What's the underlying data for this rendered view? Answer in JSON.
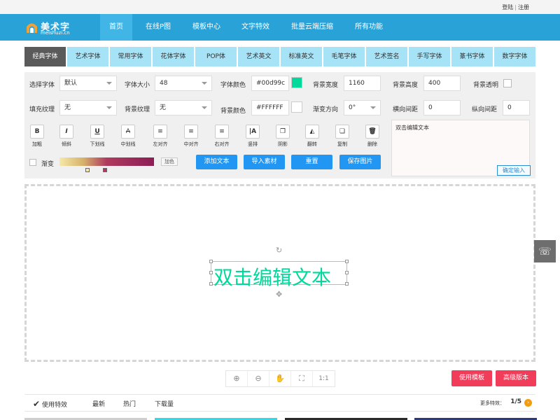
{
  "topbar": {
    "login": "登陆",
    "sep": "|",
    "register": "注册"
  },
  "logo": {
    "name": "美术字",
    "sub": "meishuzi.cn"
  },
  "nav": {
    "items": [
      "首页",
      "在线P图",
      "模板中心",
      "文字特效",
      "批量云端压缩",
      "所有功能"
    ]
  },
  "tabs": [
    "经典字体",
    "艺术字体",
    "常用字体",
    "花体字体",
    "POP体",
    "艺术英文",
    "标准英文",
    "毛笔字体",
    "艺术签名",
    "手写字体",
    "篆书字体",
    "数字字体"
  ],
  "form": {
    "font_label": "选择字体",
    "font_value": "默认",
    "size_label": "字体大小",
    "size_value": "48",
    "color_label": "字体颜色",
    "color_value": "#00d99c",
    "bgwidth_label": "背景宽度",
    "bgwidth_value": "1160",
    "bgheight_label": "背景高度",
    "bgheight_value": "400",
    "bgtrans_label": "背景透明",
    "fill_label": "填充纹理",
    "fill_value": "无",
    "bgtexture_label": "背景纹理",
    "bgtexture_value": "无",
    "bgcolor_label": "背景颜色",
    "bgcolor_value": "#FFFFFF",
    "graddir_label": "渐变方向",
    "graddir_value": "0°",
    "hgap_label": "横向间距",
    "hgap_value": "0",
    "vgap_label": "纵向间距",
    "vgap_value": "0",
    "gradient_label": "渐变",
    "addcolor_label": "加色"
  },
  "tools": [
    "加粗",
    "倾斜",
    "下划线",
    "中划线",
    "左对齐",
    "中对齐",
    "右对齐",
    "竖排",
    "阴影",
    "翻转",
    "复制",
    "删除"
  ],
  "actions": [
    "添加文本",
    "导入素材",
    "重置",
    "保存图片"
  ],
  "textarea": {
    "value": "双击编辑文本",
    "confirm": "确定输入"
  },
  "canvas": {
    "text": "双击编辑文本"
  },
  "zoom": {
    "ratio": "1:1"
  },
  "buttons": {
    "template": "使用模板",
    "advanced": "高级版本"
  },
  "bottom": {
    "items": [
      "使用特效",
      "最新",
      "热门",
      "下载量"
    ],
    "more": "更多特效：",
    "page": "1/5"
  },
  "colors": {
    "nav": "#29a2d8",
    "accent": "#00d99c",
    "tab": "#a7e3f7",
    "button": "#2196f3",
    "pink": "#f23d5a"
  }
}
